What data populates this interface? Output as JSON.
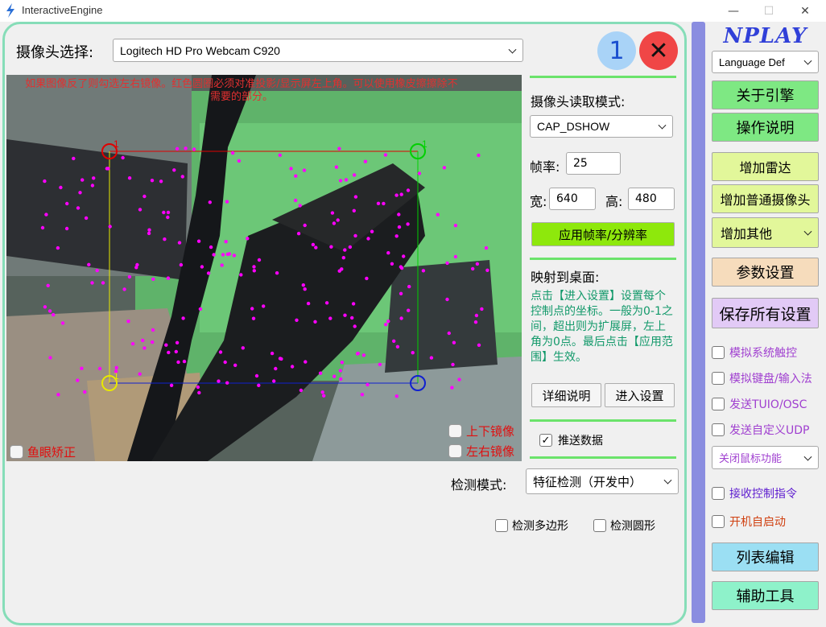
{
  "window": {
    "title": "InteractiveEngine",
    "minimize": "—",
    "maximize": "☐",
    "close": "✕"
  },
  "camera_select": {
    "label": "摄像头选择:",
    "value": "Logitech HD Pro Webcam C920"
  },
  "top_badges": {
    "count": "1",
    "close_glyph": "✕"
  },
  "preview": {
    "instruction": "如果图像反了则勾选左右镜像。红色圆圈必须对准投影/显示屏左上角。可以使用橡皮擦擦除不需要的部分。",
    "corner_marks": [
      "1",
      "1",
      "1"
    ],
    "fisheye_label": "鱼眼矫正",
    "flip_vertical_label": "上下镜像",
    "flip_horizontal_label": "左右镜像"
  },
  "capture": {
    "mode_label": "摄像头读取模式:",
    "mode_value": "CAP_DSHOW",
    "fps_label": "帧率:",
    "fps_value": "25",
    "width_label": "宽:",
    "width_value": "640",
    "height_label": "高:",
    "height_value": "480",
    "apply_button": "应用帧率/分辨率"
  },
  "mapping": {
    "title": "映射到桌面:",
    "description": "点击【进入设置】设置每个控制点的坐标。一般为0-1之间，超出则为扩展屏，左上角为0点。最后点击【应用范围】生效。",
    "detail_button": "详细说明",
    "enter_button": "进入设置",
    "push_data_label": "推送数据",
    "push_data_checked": true
  },
  "detection": {
    "mode_label": "检测模式:",
    "mode_value": "特征检测（开发中）",
    "polygon_label": "检测多边形",
    "circle_label": "检测圆形"
  },
  "sidebar": {
    "logo": "NPLAY",
    "language": "Language Def",
    "about": "关于引擎",
    "guide": "操作说明",
    "add_radar": "增加雷达",
    "add_camera": "增加普通摄像头",
    "add_other": "增加其他",
    "params": "参数设置",
    "save_all": "保存所有设置",
    "sim_touch": "模拟系统触控",
    "sim_keyboard": "模拟键盘/输入法",
    "send_tuio": "发送TUIO/OSC",
    "send_udp": "发送自定义UDP",
    "mouse_select": "关闭鼠标功能",
    "receive_cmd": "接收控制指令",
    "autostart": "开机自启动",
    "list_edit": "列表编辑",
    "tools": "辅助工具"
  },
  "colors": {
    "panel_border": "#86ddb8",
    "divider": "#8a8de0",
    "green_button": "#7ee883",
    "apply_button": "#8ee80c",
    "yellow_button": "#e2f79a",
    "orange_button": "#f6dcbc",
    "lavender_button": "#e2caf6",
    "cyan_button": "#9bdff3",
    "teal_button": "#8ef2ca",
    "separator": "#6be36b",
    "marker_red": "#e00000",
    "marker_green": "#00d000",
    "marker_yellow": "#e8e800",
    "marker_blue": "#1020d0",
    "dots": "#ff00ff"
  },
  "icons": [
    "lightning-icon",
    "chevron-down-icon",
    "close-icon",
    "checkmark-icon"
  ]
}
